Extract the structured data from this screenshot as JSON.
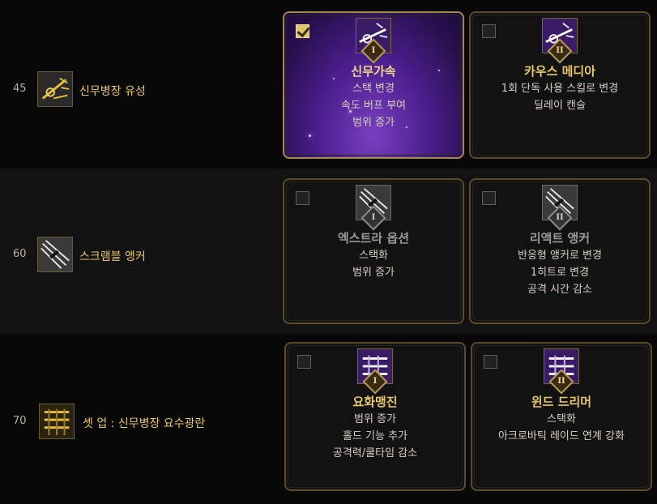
{
  "rows": [
    {
      "level": "45",
      "skill_name": "신무병장 유성",
      "skill_icon": "comet-spear-icon",
      "options": [
        {
          "checked": true,
          "tier": "I",
          "title": "신무가속",
          "lines": [
            "스택 변경",
            "속도 버프 부여",
            "범위 증가"
          ],
          "icon": "comet-spear-icon"
        },
        {
          "checked": false,
          "tier": "II",
          "title": "카우스 메디아",
          "lines": [
            "1회 단독 사용 스킬로 변경",
            "딜레이 캔슬"
          ],
          "icon": "comet-spear-icon"
        }
      ]
    },
    {
      "level": "60",
      "skill_name": "스크램블 앵커",
      "skill_icon": "scramble-anchor-icon",
      "options": [
        {
          "checked": false,
          "tier": "I",
          "title": "엑스트라 옵션",
          "lines": [
            "스택화",
            "범위 증가"
          ],
          "icon": "scramble-anchor-icon"
        },
        {
          "checked": false,
          "tier": "II",
          "title": "리액트 앵커",
          "lines": [
            "반응형 앵커로 변경",
            "1히트로 변경",
            "공격 시간 감소"
          ],
          "icon": "scramble-anchor-icon"
        }
      ]
    },
    {
      "level": "70",
      "skill_name": "셋 업 : 신무병장 요수광란",
      "skill_icon": "yosu-gwangran-icon",
      "options": [
        {
          "checked": false,
          "tier": "I",
          "title": "요화맹진",
          "lines": [
            "범위 증가",
            "홀드 기능 추가",
            "공격력/쿨타임 감소"
          ],
          "icon": "yosu-gwangran-icon"
        },
        {
          "checked": false,
          "tier": "II",
          "title": "윈드 드리머",
          "lines": [
            "스택화",
            "아크로바틱 레이드 연계 강화"
          ],
          "icon": "yosu-gwangran-icon"
        }
      ]
    }
  ]
}
